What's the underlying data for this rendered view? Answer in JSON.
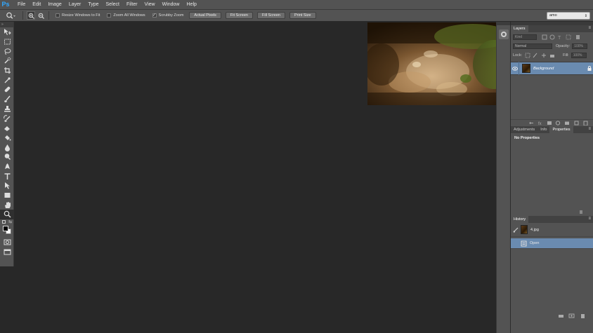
{
  "menubar": {
    "logo": "Ps",
    "items": [
      "File",
      "Edit",
      "Image",
      "Layer",
      "Type",
      "Select",
      "Filter",
      "View",
      "Window",
      "Help"
    ]
  },
  "options": {
    "checkboxes": [
      {
        "label": "Resize Windows to Fit",
        "checked": false
      },
      {
        "label": "Zoom All Windows",
        "checked": false
      },
      {
        "label": "Scrubby Zoom",
        "checked": true
      }
    ],
    "buttons": [
      "Actual Pixels",
      "Fit Screen",
      "Fill Screen",
      "Print Size"
    ],
    "workspace": "amo"
  },
  "toolbar": {
    "tools": [
      "move-tool",
      "marquee-tool",
      "lasso-tool",
      "quick-select-tool",
      "crop-tool",
      "eyedropper-tool",
      "healing-brush-tool",
      "brush-tool",
      "clone-stamp-tool",
      "history-brush-tool",
      "eraser-tool",
      "paint-bucket-tool",
      "blur-tool",
      "dodge-tool",
      "pen-tool",
      "type-tool",
      "path-selection-tool",
      "rectangle-tool",
      "hand-tool",
      "zoom-tool"
    ],
    "active_tool": "zoom-tool",
    "foreground_color": "#000000",
    "background_color": "#ffffff"
  },
  "layers_panel": {
    "tab": "Layers",
    "filter": "Kind",
    "blend_mode": "Normal",
    "opacity_label": "Opacity:",
    "opacity_value": "100%",
    "lock_label": "Lock:",
    "fill_label": "Fill:",
    "fill_value": "100%",
    "layers": [
      {
        "name": "Background",
        "visible": true,
        "locked": true
      }
    ]
  },
  "properties_panel": {
    "tabs": [
      "Adjustments",
      "Info",
      "Properties"
    ],
    "active_tab": "Properties",
    "content": "No Properties"
  },
  "history_panel": {
    "tab": "History",
    "snapshot": "4.jpg",
    "states": [
      {
        "name": "Open",
        "selected": true
      }
    ]
  },
  "colors": {
    "accent": "#31a8ff",
    "selection": "#6a8bb0"
  }
}
